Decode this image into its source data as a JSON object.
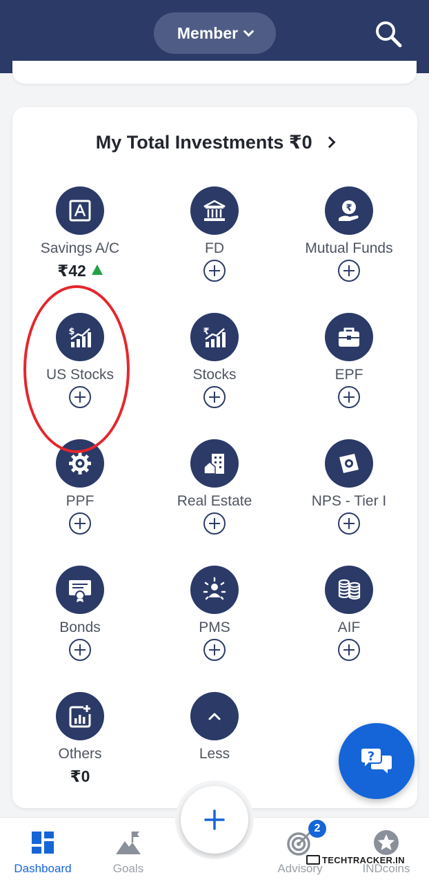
{
  "header": {
    "member_label": "Member",
    "search_icon": "search-icon"
  },
  "investments": {
    "title": "My Total Investments ₹0",
    "items": [
      {
        "label": "Savings A/C",
        "icon": "savings-account-icon",
        "value": "₹42",
        "trend": "up"
      },
      {
        "label": "FD",
        "icon": "bank-building-icon"
      },
      {
        "label": "Mutual Funds",
        "icon": "rupee-hand-icon"
      },
      {
        "label": "US Stocks",
        "icon": "dollar-growth-chart-icon"
      },
      {
        "label": "Stocks",
        "icon": "rupee-growth-chart-icon"
      },
      {
        "label": "EPF",
        "icon": "briefcase-icon"
      },
      {
        "label": "PPF",
        "icon": "gear-cog-icon"
      },
      {
        "label": "Real Estate",
        "icon": "building-house-icon"
      },
      {
        "label": "NPS - Tier I",
        "icon": "pension-note-icon"
      },
      {
        "label": "Bonds",
        "icon": "certificate-icon"
      },
      {
        "label": "PMS",
        "icon": "portfolio-manager-icon"
      },
      {
        "label": "AIF",
        "icon": "coin-stacks-icon"
      },
      {
        "label": "Others",
        "icon": "add-chart-icon",
        "value": "₹0"
      },
      {
        "label": "Less",
        "icon": "chevron-up-icon"
      }
    ]
  },
  "colors": {
    "header_bg": "#2b3a67",
    "icon_bg": "#2b3a67",
    "accent_blue": "#1565d8",
    "trend_up": "#23a145",
    "highlight_ring": "#e4262c"
  },
  "bottom_nav": {
    "items": [
      {
        "label": "Dashboard",
        "icon": "dashboard-icon",
        "active": true
      },
      {
        "label": "Goals",
        "icon": "mountain-flag-icon"
      },
      {
        "label": "Advisory",
        "icon": "target-icon",
        "badge": "2"
      },
      {
        "label": "INDcoins",
        "icon": "star-coin-icon"
      }
    ],
    "center_button_icon": "plus-icon"
  },
  "help_button_icon": "chat-help-icon",
  "watermark": "TECHTRACKER.IN"
}
